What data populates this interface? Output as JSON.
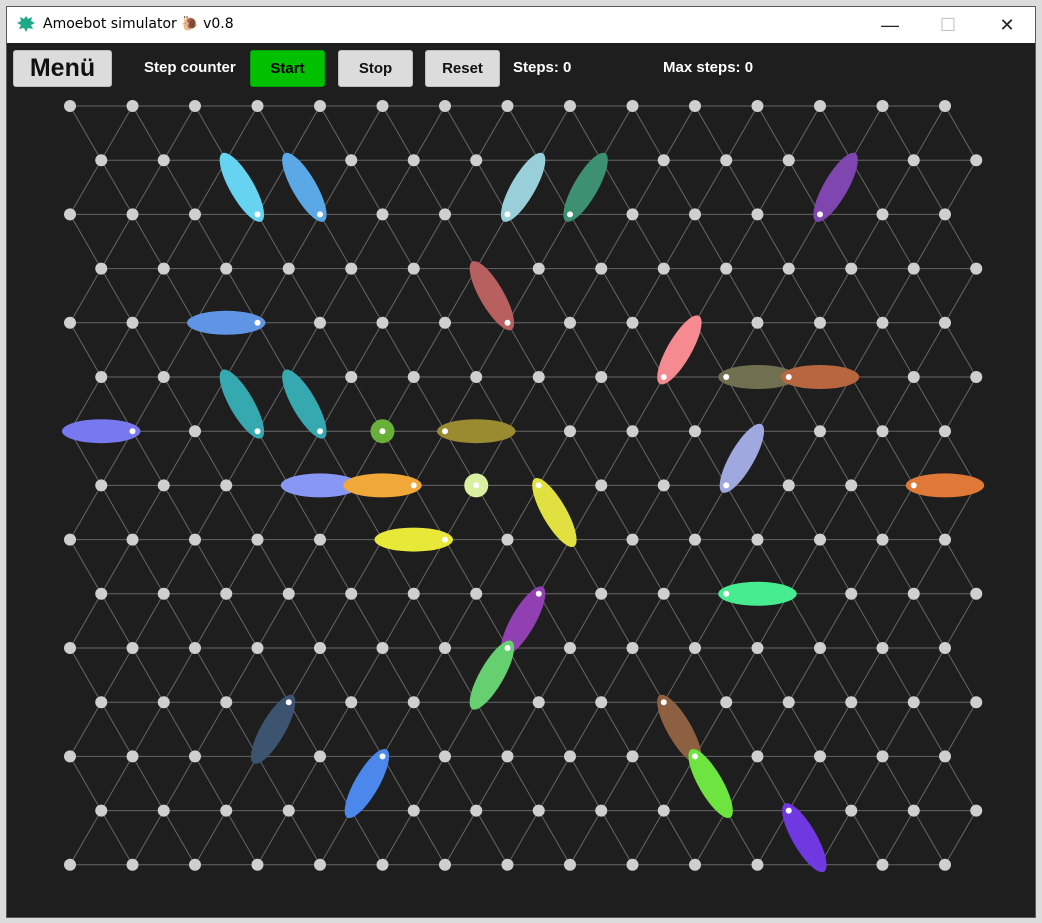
{
  "window": {
    "title": "Amoebot simulator 🐌 v0.8",
    "controls": {
      "minimize": "—",
      "maximize": "☐",
      "close": "✕"
    },
    "icon": "amoeba-icon"
  },
  "toolbar": {
    "menu_label": "Menü",
    "step_counter_label": "Step counter",
    "start_label": "Start",
    "stop_label": "Stop",
    "reset_label": "Reset",
    "steps_text": "Steps: 0",
    "max_steps_text": "Max steps: 0",
    "start_color": "#00c000"
  },
  "grid": {
    "node_color": "#cfcfcf",
    "line_color": "#666666",
    "rows": 15
  },
  "particles": [
    {
      "row": 2,
      "col": 6,
      "dir": "NW",
      "color": "#66d4f0"
    },
    {
      "row": 2,
      "col": 8,
      "dir": "NW",
      "color": "#5aa8e6"
    },
    {
      "row": 2,
      "col": 14,
      "dir": "NE",
      "color": "#99cfd8"
    },
    {
      "row": 2,
      "col": 16,
      "dir": "NE",
      "color": "#3d9070"
    },
    {
      "row": 2,
      "col": 24,
      "dir": "NE",
      "color": "#8046b0"
    },
    {
      "row": 4,
      "col": 14,
      "dir": "NW",
      "color": "#b86060"
    },
    {
      "row": 4,
      "col": 6,
      "dir": "W",
      "color": "#5f95e4"
    },
    {
      "row": 5,
      "col": 19,
      "dir": "NE",
      "color": "#f58a90"
    },
    {
      "row": 5,
      "col": 21,
      "dir": "E",
      "color": "#707050"
    },
    {
      "row": 5,
      "col": 23,
      "dir": "E",
      "color": "#b86640"
    },
    {
      "row": 6,
      "col": 6,
      "dir": "NW",
      "color": "#36a8b0"
    },
    {
      "row": 6,
      "col": 8,
      "dir": "NW",
      "color": "#36a8b0"
    },
    {
      "row": 6,
      "col": 2,
      "dir": "W",
      "color": "#7878f0"
    },
    {
      "row": 6,
      "col": 12,
      "dir": "E",
      "color": "#9a8a30"
    },
    {
      "row": 7,
      "col": 9,
      "dir": "W",
      "color": "#8896f4"
    },
    {
      "row": 7,
      "col": 11,
      "dir": "W",
      "color": "#f0a838"
    },
    {
      "row": 7,
      "col": 21,
      "dir": "NE",
      "color": "#a0a8e0"
    },
    {
      "row": 7,
      "col": 27,
      "dir": "E",
      "color": "#e07838"
    },
    {
      "row": 7,
      "col": 15,
      "dir": "SE",
      "color": "#e0e040"
    },
    {
      "row": 8,
      "col": 12,
      "dir": "W",
      "color": "#e8e838"
    },
    {
      "row": 9,
      "col": 21,
      "dir": "E",
      "color": "#48ec90"
    },
    {
      "row": 9,
      "col": 15,
      "dir": "SW",
      "color": "#9040b0"
    },
    {
      "row": 10,
      "col": 14,
      "dir": "SW",
      "color": "#66d070"
    },
    {
      "row": 11,
      "col": 7,
      "dir": "SW",
      "color": "#3c5470"
    },
    {
      "row": 11,
      "col": 19,
      "dir": "SE",
      "color": "#8c6040"
    },
    {
      "row": 12,
      "col": 10,
      "dir": "SW",
      "color": "#4c88ec"
    },
    {
      "row": 12,
      "col": 20,
      "dir": "SE",
      "color": "#6ee440"
    },
    {
      "row": 13,
      "col": 23,
      "dir": "SE",
      "color": "#7038e0"
    }
  ],
  "dots": [
    {
      "row": 6,
      "col": 10,
      "color": "#68b038"
    },
    {
      "row": 7,
      "col": 13,
      "color": "#d8f0a0"
    }
  ]
}
